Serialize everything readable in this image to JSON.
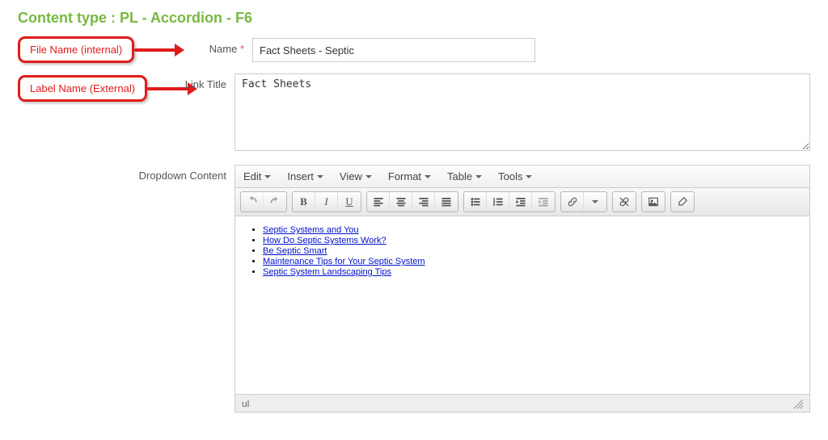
{
  "page_title": "Content type : PL - Accordion - F6",
  "annotations": {
    "name": "File Name (internal)",
    "link_title": "Label Name (External)"
  },
  "fields": {
    "name": {
      "label": "Name",
      "required": "*",
      "value": "Fact Sheets - Septic"
    },
    "link_title": {
      "label": "Link Title",
      "value": "Fact Sheets"
    },
    "dropdown_content": {
      "label": "Dropdown Content"
    }
  },
  "editor": {
    "menus": {
      "edit": "Edit",
      "insert": "Insert",
      "view": "View",
      "format": "Format",
      "table": "Table",
      "tools": "Tools"
    },
    "status_path": "ul",
    "links": [
      "Septic Systems and You",
      "How Do Septic Systems Work?",
      "Be Septic Smart",
      "Maintenance Tips for Your Septic System",
      "Septic System Landscaping Tips"
    ]
  }
}
